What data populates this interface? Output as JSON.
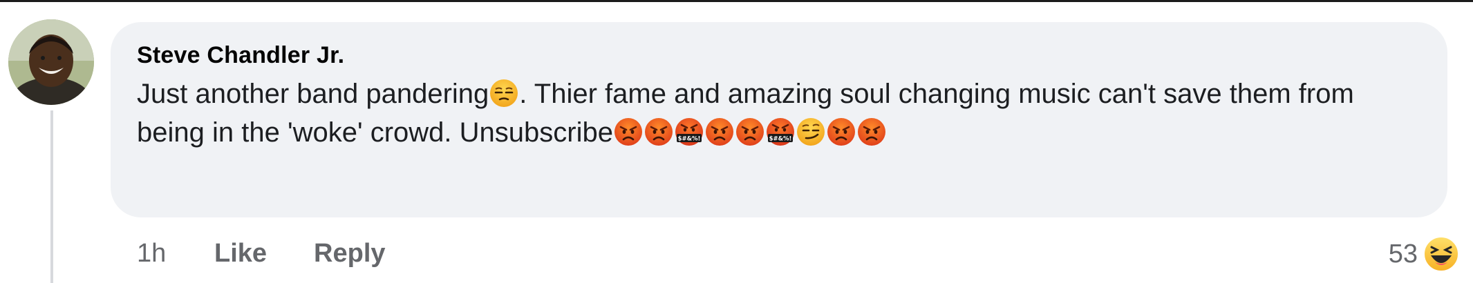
{
  "comment": {
    "author": "Steve Chandler Jr.",
    "segments": [
      {
        "type": "text",
        "text": "Just another band pandering"
      },
      {
        "type": "emoji",
        "name": "unamused-face-icon"
      },
      {
        "type": "text",
        "text": ". Thier fame and amazing soul changing music can't save them from being in the 'woke' crowd. Unsubscribe"
      },
      {
        "type": "emoji",
        "name": "angry-face-icon"
      },
      {
        "type": "emoji",
        "name": "angry-face-icon"
      },
      {
        "type": "emoji",
        "name": "face-with-symbols-on-mouth-icon"
      },
      {
        "type": "emoji",
        "name": "angry-face-icon"
      },
      {
        "type": "emoji",
        "name": "angry-face-icon"
      },
      {
        "type": "emoji",
        "name": "face-with-symbols-on-mouth-icon"
      },
      {
        "type": "emoji",
        "name": "smirking-face-icon"
      },
      {
        "type": "emoji",
        "name": "angry-face-icon"
      },
      {
        "type": "emoji",
        "name": "angry-face-icon"
      }
    ]
  },
  "actions": {
    "time": "1h",
    "like_label": "Like",
    "reply_label": "Reply"
  },
  "reactions": {
    "count": "53",
    "icon": "haha-reaction-icon"
  },
  "colors": {
    "bubble": "#f0f2f5",
    "author": "#050505",
    "meta": "#65676b"
  }
}
